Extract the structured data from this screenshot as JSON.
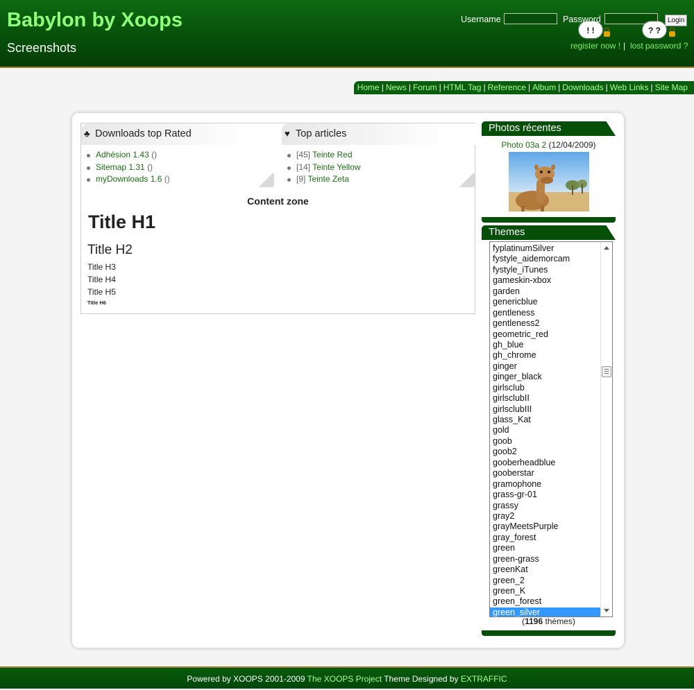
{
  "header": {
    "site_name": "Babylon by Xoops",
    "slogan": "Screenshots",
    "username_label": "Username",
    "password_label": "Password",
    "login_button": "Login",
    "register_link": "register now !",
    "separator": "|",
    "lost_password_link": "lost password ?",
    "register_cloud_text": "! !",
    "lost_cloud_text": "? ?"
  },
  "nav": {
    "items": [
      "Home",
      "News",
      "Forum",
      "HTML Tag",
      "Reference",
      "Album",
      "Downloads",
      "Web Links",
      "Site Map"
    ],
    "separator": "|"
  },
  "blocks": {
    "downloads": {
      "title": "Downloads top Rated",
      "icon": "club-icon",
      "items": [
        {
          "name": "Adhésion 1.43",
          "suffix": "()"
        },
        {
          "name": "Sitemap 1.31",
          "suffix": "()"
        },
        {
          "name": "myDownloads 1.6",
          "suffix": "()"
        }
      ]
    },
    "articles": {
      "title": "Top articles",
      "icon": "heart-icon",
      "items": [
        {
          "count": "[45]",
          "name": "Teinte Red"
        },
        {
          "count": "[14]",
          "name": "Teinte Yellow"
        },
        {
          "count": "[9]",
          "name": "Teinte Zeta"
        }
      ]
    }
  },
  "content": {
    "zone_label": "Content zone",
    "h1": "Title H1",
    "h2": "Title H2",
    "h3": "Title H3",
    "h4": "Title H4",
    "h5": "Title H5",
    "h6": "Title H6"
  },
  "photos": {
    "title": "Photos récentes",
    "photo_title": "Photo 03a 2",
    "photo_date": "(12/04/2009)"
  },
  "themes": {
    "title": "Themes",
    "options": [
      "fyplatinumSilver",
      "fystyle_aidemorcam",
      "fystyle_iTunes",
      "gameskin-xbox",
      "garden",
      "genericblue",
      "gentleness",
      "gentleness2",
      "geometric_red",
      "gh_blue",
      "gh_chrome",
      "ginger",
      "ginger_black",
      "girlsclub",
      "girlsclubII",
      "girlsclubIII",
      "glass_Kat",
      "gold",
      "goob",
      "goob2",
      "gooberheadblue",
      "gooberstar",
      "gramophone",
      "grass-gr-01",
      "grassy",
      "gray2",
      "grayMeetsPurple",
      "gray_forest",
      "green",
      "green-grass",
      "greenKat",
      "green_2",
      "green_K",
      "green_forest",
      "green_silver"
    ],
    "selected": "green_silver",
    "count_open": "(",
    "count": "1196",
    "count_label": " thèmes)"
  },
  "footer": {
    "powered": "Powered by XOOPS 2001-2009",
    "project_link": "The XOOPS Project",
    "designed": "Theme Designed by",
    "designer_link": "EXTRAFFIC"
  },
  "colors": {
    "header_green": "#07500a",
    "link_green": "#1a6e12",
    "light_green": "#8fff7b",
    "selection_blue": "#3399ff",
    "border_gold": "#a67a32"
  }
}
